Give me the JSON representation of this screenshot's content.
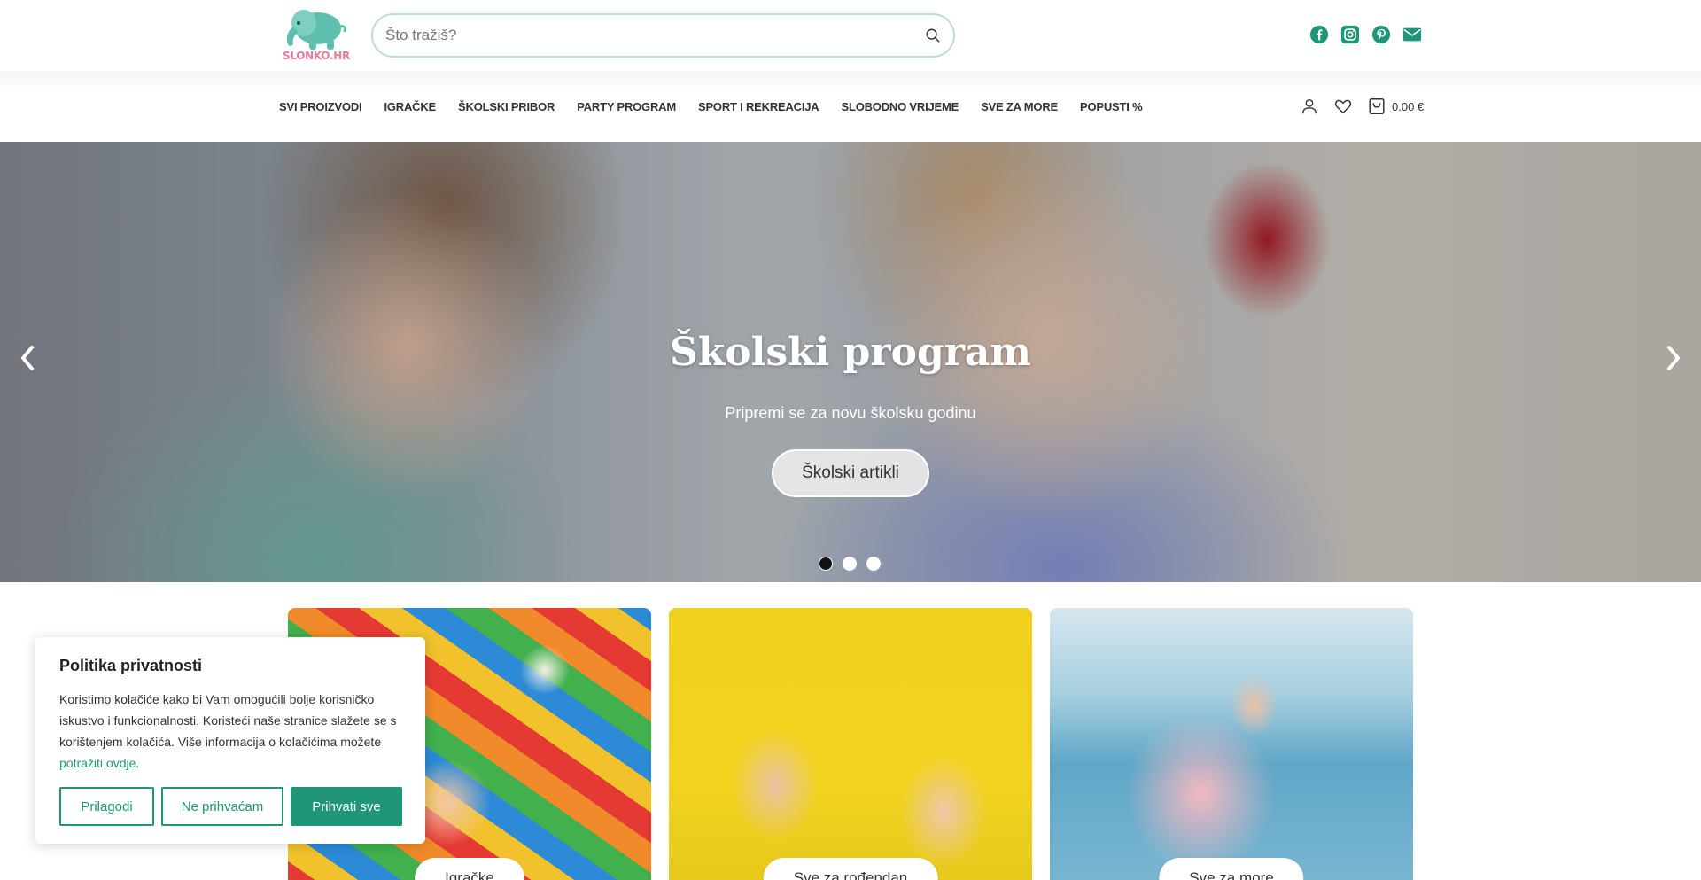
{
  "header": {
    "logo_text": "SLONKO.HR",
    "search": {
      "placeholder": "Što tražiš?",
      "value": ""
    },
    "social": [
      "facebook-icon",
      "instagram-icon",
      "pinterest-icon",
      "email-icon"
    ]
  },
  "nav": {
    "items": [
      {
        "label": "SVI PROIZVODI"
      },
      {
        "label": "IGRAČKE"
      },
      {
        "label": "ŠKOLSKI PRIBOR"
      },
      {
        "label": "PARTY PROGRAM"
      },
      {
        "label": "SPORT I REKREACIJA"
      },
      {
        "label": "SLOBODNO VRIJEME"
      },
      {
        "label": "SVE ZA MORE"
      },
      {
        "label": "POPUSTI %"
      }
    ],
    "cart_total": "0.00 €"
  },
  "hero": {
    "title": "Školski program",
    "subtitle": "Pripremi se za novu školsku godinu",
    "button": "Školski artikli",
    "active_slide": 1,
    "slide_count": 3
  },
  "categories": [
    {
      "label": "Igračke"
    },
    {
      "label": "Sve za rođendan"
    },
    {
      "label": "Sve za more"
    }
  ],
  "cookie": {
    "title": "Politika privatnosti",
    "text": "Koristimo kolačiće kako bi Vam omogućili bolje korisničko iskustvo i funkcionalnosti. Koristeći naše stranice slažete se s korištenjem kolačića. Više informacija o kolačićima možete ",
    "link": "potražiti ovdje.",
    "buttons": {
      "customize": "Prilagodi",
      "decline": "Ne prihvaćam",
      "accept": "Prihvati sve"
    }
  },
  "colors": {
    "brand": "#1f9677",
    "logo_pink": "#e97aa0",
    "logo_teal": "#5fbfae"
  }
}
